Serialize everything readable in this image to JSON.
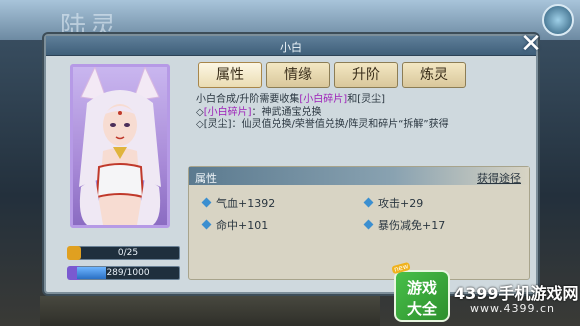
{
  "background": {
    "title_text": "陆灵"
  },
  "panel": {
    "title": "小白",
    "close_label": "✕"
  },
  "tabs": [
    {
      "label": "属性",
      "active": true
    },
    {
      "label": "情缘",
      "active": false
    },
    {
      "label": "升阶",
      "active": false
    },
    {
      "label": "炼灵",
      "active": false
    }
  ],
  "description": {
    "line1_prefix": "小白合成/升阶需要收集",
    "line1_item1": "[小白碎片]",
    "line1_mid": "和",
    "line1_item2": "[灵尘]",
    "line2_prefix": "◇",
    "line2_item": "[小白碎片]",
    "line2_text": "：神武通宝兑换",
    "line3": "◇[灵尘]：仙灵值兑换/荣誉值兑换/阵灵和碎片“拆解”获得"
  },
  "attributes": {
    "header": "属性",
    "obtain_link": "获得途径",
    "stats": [
      {
        "label": "气血+1392"
      },
      {
        "label": "攻击+29"
      },
      {
        "label": "命中+101"
      },
      {
        "label": "暴伤减免+17"
      }
    ]
  },
  "bars": {
    "shard_text": "0/25",
    "shard_progress": 0.0,
    "dust_text": "289/1000",
    "dust_progress": 0.289
  },
  "watermark": {
    "logo_line1": "游戏",
    "logo_line2": "大全",
    "logo_badge": "new",
    "brand": "4399手机游戏网",
    "site": "www.4399.cn"
  },
  "colors": {
    "highlight": "#9d1fb8",
    "bar_fill": "#3b8fd0",
    "portrait_frame": "#b69ae6"
  }
}
